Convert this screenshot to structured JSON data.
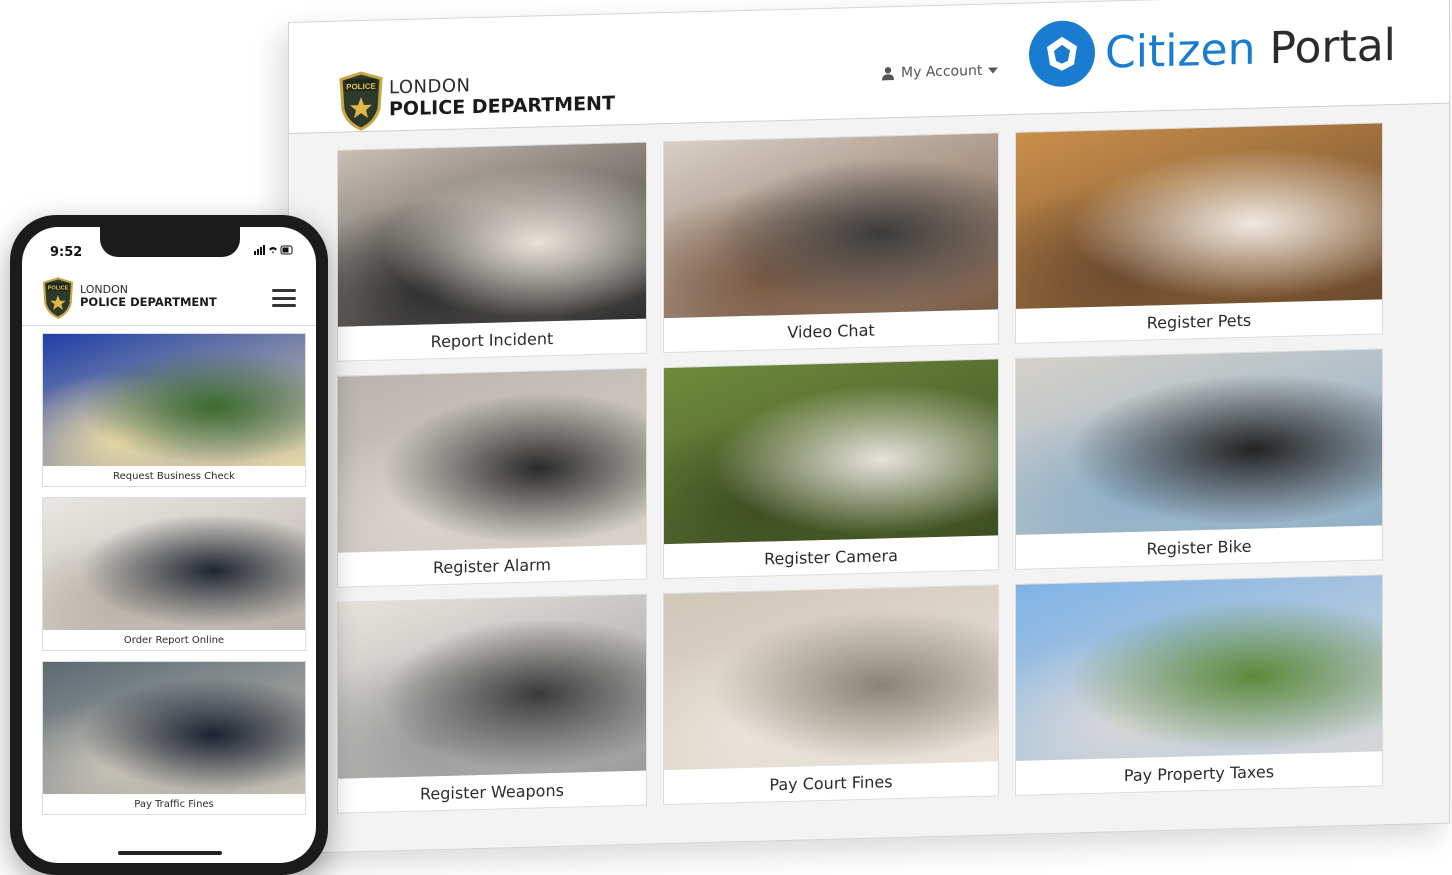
{
  "desktop": {
    "dept_line1": "LONDON",
    "dept_line2": "POLICE DEPARTMENT",
    "badge_text": "POLICE",
    "account_label": "My Account",
    "portal_word1": "Citizen",
    "portal_word2": "Portal",
    "tiles": [
      {
        "label": "Report Incident",
        "scene": "hands-phone",
        "colors": [
          "#c9bfb4",
          "#e8e2da",
          "#2d2d2d"
        ]
      },
      {
        "label": "Video Chat",
        "scene": "tablet-call",
        "colors": [
          "#d7cfc6",
          "#3b3b3b",
          "#7a5a44"
        ]
      },
      {
        "label": "Register Pets",
        "scene": "golden-dog",
        "colors": [
          "#c98f4a",
          "#efe9e2",
          "#6b4a2e"
        ]
      },
      {
        "label": "Register Alarm",
        "scene": "alarm-keypad",
        "colors": [
          "#b9b4ad",
          "#2a2a2a",
          "#d8d3cc"
        ]
      },
      {
        "label": "Register Camera",
        "scene": "security-camera",
        "colors": [
          "#6f8a3c",
          "#e6e2dc",
          "#3e4e22"
        ]
      },
      {
        "label": "Register Bike",
        "scene": "bicycle",
        "colors": [
          "#d4d0c9",
          "#222222",
          "#8fb0c8"
        ]
      },
      {
        "label": "Register Weapons",
        "scene": "pistol-form",
        "colors": [
          "#e7e4de",
          "#3a3a3a",
          "#9c9c9c"
        ]
      },
      {
        "label": "Pay Court Fines",
        "scene": "courthouse",
        "colors": [
          "#cfc7b8",
          "#8a8478",
          "#e9e4da"
        ]
      },
      {
        "label": "Pay Property Taxes",
        "scene": "house",
        "colors": [
          "#7fb3e6",
          "#5d8a3a",
          "#d7d7d7"
        ]
      }
    ]
  },
  "phone": {
    "time": "9:52",
    "status_icons": "wifi battery",
    "dept_line1": "LONDON",
    "dept_line2": "POLICE DEPARTMENT",
    "badge_text": "POLICE",
    "tiles": [
      {
        "label": "Request Business Check",
        "scene": "house-night",
        "colors": [
          "#1f3fa8",
          "#3c6b2e",
          "#e8d9a6"
        ]
      },
      {
        "label": "Order Report Online",
        "scene": "officer-paperwork",
        "colors": [
          "#e9e7e3",
          "#1e2530",
          "#b9b2a8"
        ]
      },
      {
        "label": "Pay Traffic Fines",
        "scene": "traffic-stop",
        "colors": [
          "#5c6a72",
          "#1c2330",
          "#c7c2b8"
        ]
      }
    ]
  }
}
